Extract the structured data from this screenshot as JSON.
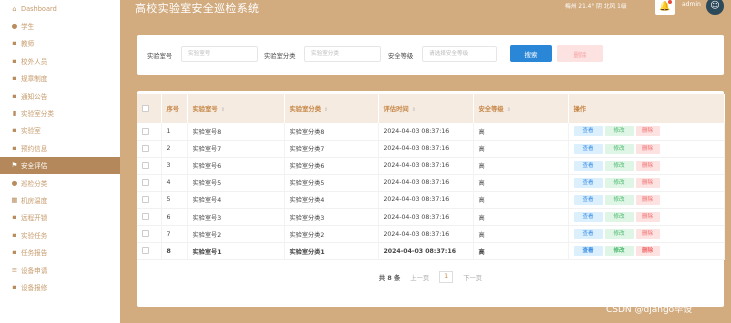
{
  "header": {
    "title": "高校实验室安全巡检系统",
    "weather": "梅州  21.4°  阴  北风  1级",
    "username": "admin"
  },
  "sidebar": {
    "items": [
      {
        "label": "Dashboard",
        "icon": "home-icon",
        "glyph": "⌂"
      },
      {
        "label": "学生",
        "icon": "user-icon",
        "glyph": "●"
      },
      {
        "label": "教师",
        "icon": "grid-icon",
        "glyph": "▪"
      },
      {
        "label": "校外人员",
        "icon": "grid-icon",
        "glyph": "▪"
      },
      {
        "label": "规章制度",
        "icon": "grid-icon",
        "glyph": "▪"
      },
      {
        "label": "通知公告",
        "icon": "lock-icon",
        "glyph": "▪"
      },
      {
        "label": "实验室分类",
        "icon": "bar-chart-icon",
        "glyph": "▮"
      },
      {
        "label": "实验室",
        "icon": "grid-icon",
        "glyph": "▪"
      },
      {
        "label": "预约信息",
        "icon": "grid-icon",
        "glyph": "▪"
      },
      {
        "label": "安全评估",
        "icon": "flag-icon",
        "glyph": "⚑",
        "active": true
      },
      {
        "label": "巡检分类",
        "icon": "person-icon",
        "glyph": "●"
      },
      {
        "label": "机房温度",
        "icon": "table-icon",
        "glyph": "▦"
      },
      {
        "label": "远程开锁",
        "icon": "grid-icon",
        "glyph": "▪"
      },
      {
        "label": "实验任务",
        "icon": "grid-icon",
        "glyph": "▪"
      },
      {
        "label": "任务报告",
        "icon": "grid-icon",
        "glyph": "▪"
      },
      {
        "label": "设备申请",
        "icon": "list-icon",
        "glyph": "≡"
      },
      {
        "label": "设备报修",
        "icon": "grid-icon",
        "glyph": "▪"
      }
    ]
  },
  "search": {
    "lab_label": "实验室号",
    "lab_placeholder": "实验室号",
    "category_label": "实验室分类",
    "category_placeholder": "实验室分类",
    "level_label": "安全等级",
    "level_placeholder": "请选择安全等级",
    "search_button": "搜索",
    "delete_button": "删除"
  },
  "table": {
    "headers": [
      "序号",
      "实验室号",
      "实验室分类",
      "评估时间",
      "安全等级",
      "操作"
    ],
    "actions": {
      "view": "查看",
      "edit": "修改",
      "delete": "删除"
    },
    "rows": [
      {
        "no": "1",
        "lab": "实验室号8",
        "category": "实验室分类8",
        "time": "2024-04-03 08:37:16",
        "level": "高"
      },
      {
        "no": "2",
        "lab": "实验室号7",
        "category": "实验室分类7",
        "time": "2024-04-03 08:37:16",
        "level": "高"
      },
      {
        "no": "3",
        "lab": "实验室号6",
        "category": "实验室分类6",
        "time": "2024-04-03 08:37:16",
        "level": "高"
      },
      {
        "no": "4",
        "lab": "实验室号5",
        "category": "实验室分类5",
        "time": "2024-04-03 08:37:16",
        "level": "高"
      },
      {
        "no": "5",
        "lab": "实验室号4",
        "category": "实验室分类4",
        "time": "2024-04-03 08:37:16",
        "level": "高"
      },
      {
        "no": "6",
        "lab": "实验室号3",
        "category": "实验室分类3",
        "time": "2024-04-03 08:37:16",
        "level": "高"
      },
      {
        "no": "7",
        "lab": "实验室号2",
        "category": "实验室分类2",
        "time": "2024-04-03 08:37:16",
        "level": "高"
      },
      {
        "no": "8",
        "lab": "实验室号1",
        "category": "实验室分类1",
        "time": "2024-04-03 08:37:16",
        "level": "高"
      }
    ]
  },
  "pagination": {
    "total": "共 8 条",
    "prev": "上一页",
    "current": "1",
    "next": "下一页"
  },
  "watermark": "CSDN @django毕设"
}
